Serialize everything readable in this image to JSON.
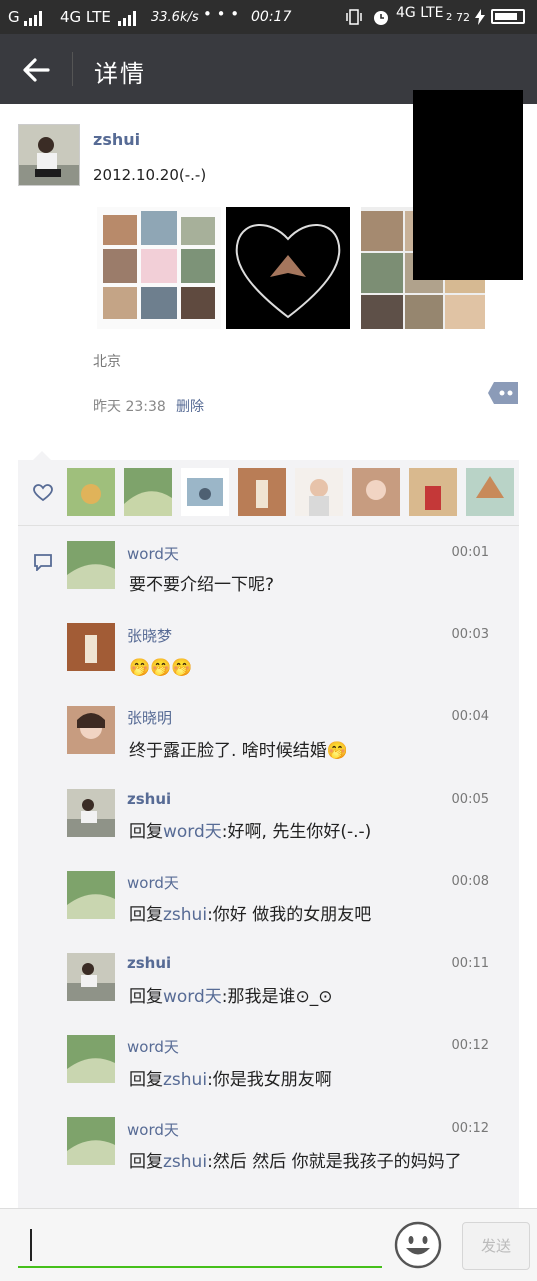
{
  "status_bar": {
    "carrier_left": "G",
    "network": "4G LTE",
    "speed": "33.6k/s",
    "dots": "• • •",
    "time": "00:17",
    "network2": "4G LTE",
    "sim2": "2",
    "battery_level": "72"
  },
  "header": {
    "title": "详情"
  },
  "post": {
    "author": "zshui",
    "text": "2012.10.20(-.-)",
    "location": "北京",
    "time": "昨天 23:38",
    "delete_label": "删除"
  },
  "comments": [
    {
      "name": "word天",
      "time": "00:01",
      "text": "要不要介绍一下呢?"
    },
    {
      "name": "张晓梦",
      "time": "00:03",
      "text": "🤭🤭🤭"
    },
    {
      "name": "张晓明",
      "time": "00:04",
      "text": "终于露正脸了. 啥时候结婚🤭"
    },
    {
      "name": "zshui",
      "time": "00:05",
      "reply_prefix": "回复",
      "reply_to": "word天",
      "text": ":好啊, 先生你好(-.-)"
    },
    {
      "name": "word天",
      "time": "00:08",
      "reply_prefix": "回复",
      "reply_to": "zshui",
      "text": ":你好  做我的女朋友吧"
    },
    {
      "name": "zshui",
      "time": "00:11",
      "reply_prefix": "回复",
      "reply_to": "word天",
      "text": ":那我是谁⊙_⊙"
    },
    {
      "name": "word天",
      "time": "00:12",
      "reply_prefix": "回复",
      "reply_to": "zshui",
      "text": ":你是我女朋友啊"
    },
    {
      "name": "word天",
      "time": "00:12",
      "reply_prefix": "回复",
      "reply_to": "zshui",
      "text": ":然后 然后 你就是我孩子的妈妈了"
    }
  ],
  "input": {
    "send_label": "发送"
  },
  "icons": {
    "back": "back-arrow-icon",
    "like": "heart-icon",
    "comment": "comment-icon",
    "more": "more-icon",
    "emoji": "emoji-icon"
  },
  "colors": {
    "accent": "#45c01a",
    "link": "#576b95",
    "header": "#393a3f"
  }
}
